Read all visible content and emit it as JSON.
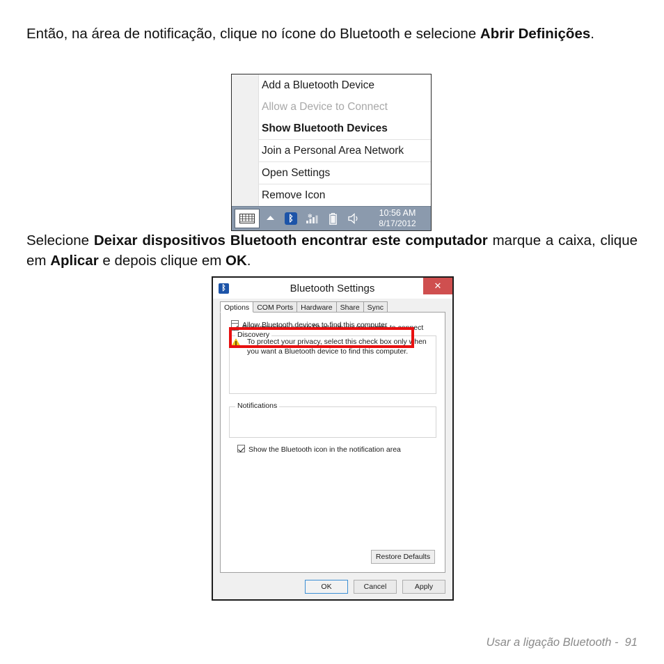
{
  "paragraphs": {
    "p1_part1": "Então, na área de notificação, clique no ícone do Bluetooth e selecione ",
    "p1_bold": "Abrir Definições",
    "p1_part2": ".",
    "p2_part1": "Selecione ",
    "p2_bold1": "Deixar dispositivos Bluetooth encontrar este computador",
    "p2_part2": " marque a caixa, clique em ",
    "p2_bold2": "Aplicar",
    "p2_part3": " e depois clique em ",
    "p2_bold3": "OK",
    "p2_part4": "."
  },
  "tray_menu": {
    "items": [
      {
        "label": "Add a Bluetooth Device",
        "state": "normal"
      },
      {
        "label": "Allow a Device to Connect",
        "state": "disabled"
      },
      {
        "label": "Show Bluetooth Devices",
        "state": "bold"
      },
      {
        "label": "Join a Personal Area Network",
        "state": "normal"
      },
      {
        "label": "Open Settings",
        "state": "normal"
      },
      {
        "label": "Remove Icon",
        "state": "normal"
      }
    ]
  },
  "taskbar": {
    "background_color": "#8b9aad",
    "bluetooth_glyph": "ᛒ",
    "chevron_glyph": "▲",
    "network_glyph": "▂▄▆",
    "battery_glyph": "▯",
    "volume_glyph": "◁",
    "time": "10:56 AM",
    "date": "8/17/2012"
  },
  "dialog": {
    "title": "Bluetooth Settings",
    "titlebar_icon_glyph": "ᛒ",
    "close_glyph": "✕",
    "close_color": "#cf4f4f",
    "tabs": [
      {
        "label": "Options",
        "active": true
      },
      {
        "label": "COM Ports",
        "active": false
      },
      {
        "label": "Hardware",
        "active": false
      },
      {
        "label": "Share",
        "active": false
      },
      {
        "label": "Sync",
        "active": false
      }
    ],
    "discovery": {
      "group_label": "Discovery",
      "checkbox_label": "Allow Bluetooth devices to find this computer",
      "checkbox_checked": true,
      "warning_text": "To protect your privacy, select this check box only when you want a Bluetooth device to find this computer."
    },
    "notifications": {
      "group_label": "Notifications",
      "checkbox_label": "Alert me when a new Bluetooth device wants to connect",
      "checkbox_checked": true
    },
    "tray_icon_option": {
      "checkbox_label": "Show the Bluetooth icon in the notification area",
      "checkbox_checked": true
    },
    "buttons": {
      "restore_defaults": "Restore Defaults",
      "ok": "OK",
      "cancel": "Cancel",
      "apply": "Apply"
    }
  },
  "annotation": {
    "color": "#e81010"
  },
  "footer": {
    "text": "Usar a ligação Bluetooth -  91"
  }
}
